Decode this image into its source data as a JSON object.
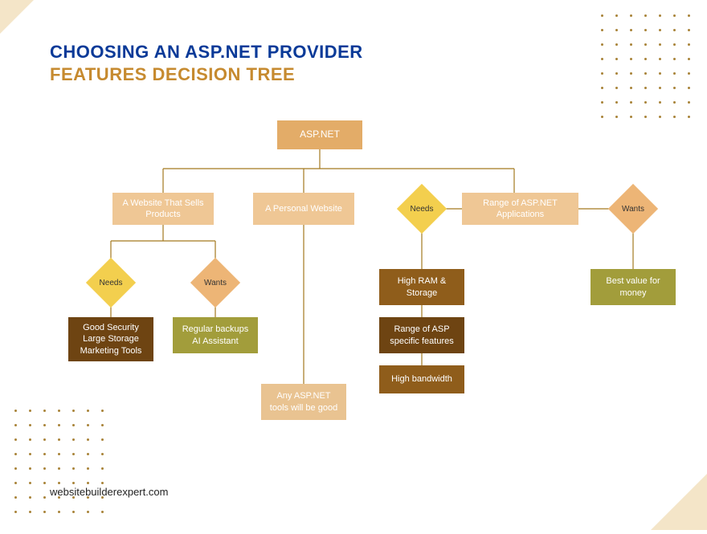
{
  "header": {
    "title": "CHOOSING AN ASP.NET PROVIDER",
    "subtitle": "FEATURES DECISION TREE"
  },
  "footer": {
    "url": "websitebuilderexpert.com"
  },
  "diagram": {
    "root": "ASP.NET",
    "branches": {
      "sells": {
        "label": "A Website That Sells Products",
        "needs_label": "Needs",
        "wants_label": "Wants",
        "needs_box": "Good Security\nLarge Storage\nMarketing Tools",
        "wants_box": "Regular backups\nAI Assistant"
      },
      "personal": {
        "label": "A Personal Website",
        "box": "Any ASP.NET tools will be good"
      },
      "apps": {
        "label": "Range of ASP.NET Applications",
        "needs_label": "Needs",
        "wants_label": "Wants",
        "needs_box_1": "High RAM & Storage",
        "needs_box_2": "Range of ASP specific features",
        "needs_box_3": "High bandwidth",
        "wants_box": "Best value for money"
      }
    }
  },
  "chart_data": {
    "type": "table",
    "title": "ASP.NET Provider Features Decision Tree",
    "root": "ASP.NET",
    "categories": [
      {
        "path": "A Website That Sells Products",
        "needs": [
          "Good Security",
          "Large Storage",
          "Marketing Tools"
        ],
        "wants": [
          "Regular backups",
          "AI Assistant"
        ]
      },
      {
        "path": "A Personal Website",
        "result": "Any ASP.NET tools will be good"
      },
      {
        "path": "Range of ASP.NET Applications",
        "needs": [
          "High RAM & Storage",
          "Range of ASP specific features",
          "High bandwidth"
        ],
        "wants": [
          "Best value for money"
        ]
      }
    ]
  },
  "colors": {
    "accent_blue": "#0a3a98",
    "accent_gold": "#c68a2f",
    "node_root": "#e3ac68",
    "node_cat": "#efc795",
    "diamond_yellow": "#f3cf4e",
    "diamond_peach": "#edb576",
    "box_brown_dark": "#6e4412",
    "box_brown_mid": "#8f5d1b",
    "box_olive": "#a29d3b",
    "box_sand": "#e9c391",
    "line": "#a4791f"
  }
}
